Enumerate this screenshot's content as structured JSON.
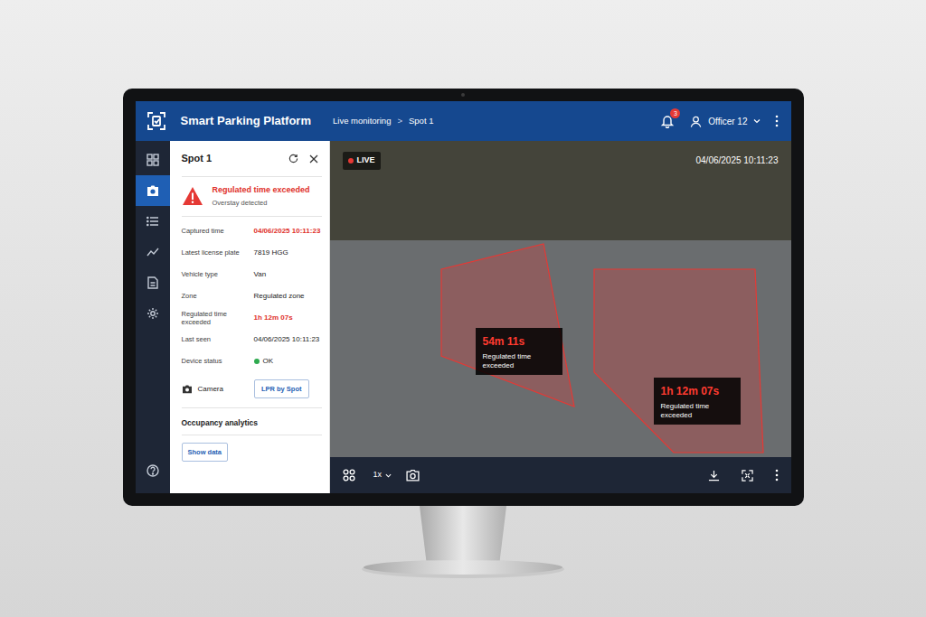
{
  "app": {
    "title": "Smart Parking Platform",
    "breadcrumb": [
      "Live monitoring",
      "Spot 1"
    ],
    "separator": ">",
    "notifications": "3",
    "user": "Officer 12"
  },
  "rail": [
    {
      "kind": "dashboard",
      "selected": false
    },
    {
      "kind": "camera",
      "selected": true
    },
    {
      "kind": "list",
      "selected": false
    },
    {
      "kind": "chart",
      "selected": false
    },
    {
      "kind": "report",
      "selected": false
    },
    {
      "kind": "settings",
      "selected": false
    },
    {
      "kind": "help",
      "selected": false
    }
  ],
  "panel": {
    "title": "Spot 1",
    "alert": {
      "title": "Regulated time exceeded",
      "subtitle": "Overstay detected"
    },
    "fields": [
      {
        "label": "Captured time",
        "value": "04/06/2025 10:11:23",
        "alert": true,
        "kind": "text"
      },
      {
        "label": "Latest license plate",
        "value": "7819 HGG",
        "alert": false,
        "kind": "text"
      },
      {
        "label": "Vehicle type",
        "value": "Van",
        "alert": false,
        "kind": "text"
      },
      {
        "label": "Zone",
        "value": "Regulated zone",
        "alert": false,
        "kind": "text"
      },
      {
        "label": "Regulated time exceeded",
        "value": "1h 12m 07s",
        "alert": true,
        "kind": "text"
      },
      {
        "label": "Last seen",
        "value": "04/06/2025 10:11:23",
        "alert": false,
        "kind": "text"
      },
      {
        "label": "Device status",
        "value": "OK",
        "alert": false,
        "kind": "status",
        "color": "#2eaa4f"
      }
    ],
    "camera": {
      "label": "Camera",
      "button": "LPR by Spot"
    },
    "analytics": {
      "title": "Occupancy analytics",
      "button": "Show data"
    }
  },
  "video": {
    "live": "LIVE",
    "timestamp": "04/06/2025 10:11:23",
    "zones": [
      {
        "duration": "54m 11s",
        "label": "Regulated time exceeded"
      },
      {
        "duration": "1h 12m 07s",
        "label": "Regulated time exceeded"
      }
    ]
  },
  "toolbar": {
    "zoom": "1x"
  }
}
